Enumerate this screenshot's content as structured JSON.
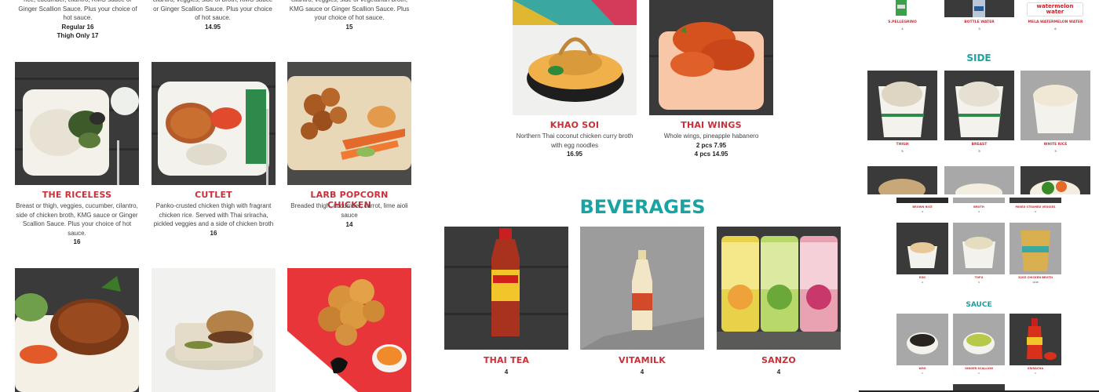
{
  "top_row": {
    "col1": {
      "desc": "rice, cucumber, cilantro, KMG sauce or Ginger Scallion Sauce. Plus your choice of hot sauce.",
      "price1": "Regular 16",
      "price2": "Thigh Only 17"
    },
    "col2": {
      "desc": "cilantro, veggies, side of broth, KMG sauce or Ginger Scallion Sauce. Plus your choice of hot sauce.",
      "price": "14.95"
    },
    "col3": {
      "desc": "cilantro, veggies, side of vegetarian broth, KMG sauce or Ginger Scallion Sauce. Plus your choice of hot sauce.",
      "price": "15"
    }
  },
  "menu_items": [
    {
      "name": "THE RICELESS",
      "desc": "Breast or thigh, veggies, cucumber, cilantro, side of chicken broth, KMG sauce or Ginger Scallion Sauce. Plus your choice of hot sauce.",
      "price": "16"
    },
    {
      "name": "CUTLET",
      "desc": "Panko-crusted chicken thigh with fragrant chicken rice. Served with Thai sriracha, pickled veggies and a side of chicken broth",
      "price": "16"
    },
    {
      "name": "LARB POPCORN CHICKEN",
      "desc": "Breaded thigh, cucumber, carrot, lime aioli sauce",
      "price": "14"
    }
  ],
  "middle_items": [
    {
      "name": "KHAO SOI",
      "desc": "Northern Thai coconut chicken curry broth with egg noodles",
      "price": "16.95"
    },
    {
      "name": "THAI WINGS",
      "desc": "Whole wings, pineapple habanero",
      "price1": "2 pcs 7.95",
      "price2": "4 pcs 14.95"
    }
  ],
  "beverages": {
    "title": "BEVERAGES",
    "items": [
      {
        "name": "THAI TEA",
        "price": "4"
      },
      {
        "name": "VITAMILK",
        "price": "4"
      },
      {
        "name": "SANZO",
        "price": "4"
      }
    ]
  },
  "right_panel": {
    "drinks": [
      {
        "name": "S.PELLEGRINO",
        "price": "4"
      },
      {
        "name": "BOTTLE WATER",
        "price": "3"
      },
      {
        "name": "MELA WATERMELON WATER",
        "price": "6"
      }
    ],
    "watermelon_label": "watermelon water",
    "side_title": "SIDE",
    "sides": [
      {
        "name": "THIGH",
        "price": "5"
      },
      {
        "name": "BREAST",
        "price": "5"
      },
      {
        "name": "WHITE RICE",
        "price": "3"
      }
    ],
    "sides2": [
      {
        "name": "BROWN RICE",
        "price": "3"
      },
      {
        "name": "BROTH",
        "price": "3"
      },
      {
        "name": "MIXED STEAMED VEGGIES",
        "price": "5"
      }
    ],
    "sides3": [
      {
        "name": "EGG",
        "price": "2"
      },
      {
        "name": "TOFU",
        "price": "3"
      },
      {
        "name": "32OZ CHICKEN BROTH",
        "price": "10.95"
      }
    ],
    "sauce_title": "SAUCE",
    "sauces": [
      {
        "name": "KMG",
        "price": "1"
      },
      {
        "name": "GINGER SCALLION",
        "price": "1"
      },
      {
        "name": "SRIRACHA",
        "price": "1"
      }
    ]
  }
}
